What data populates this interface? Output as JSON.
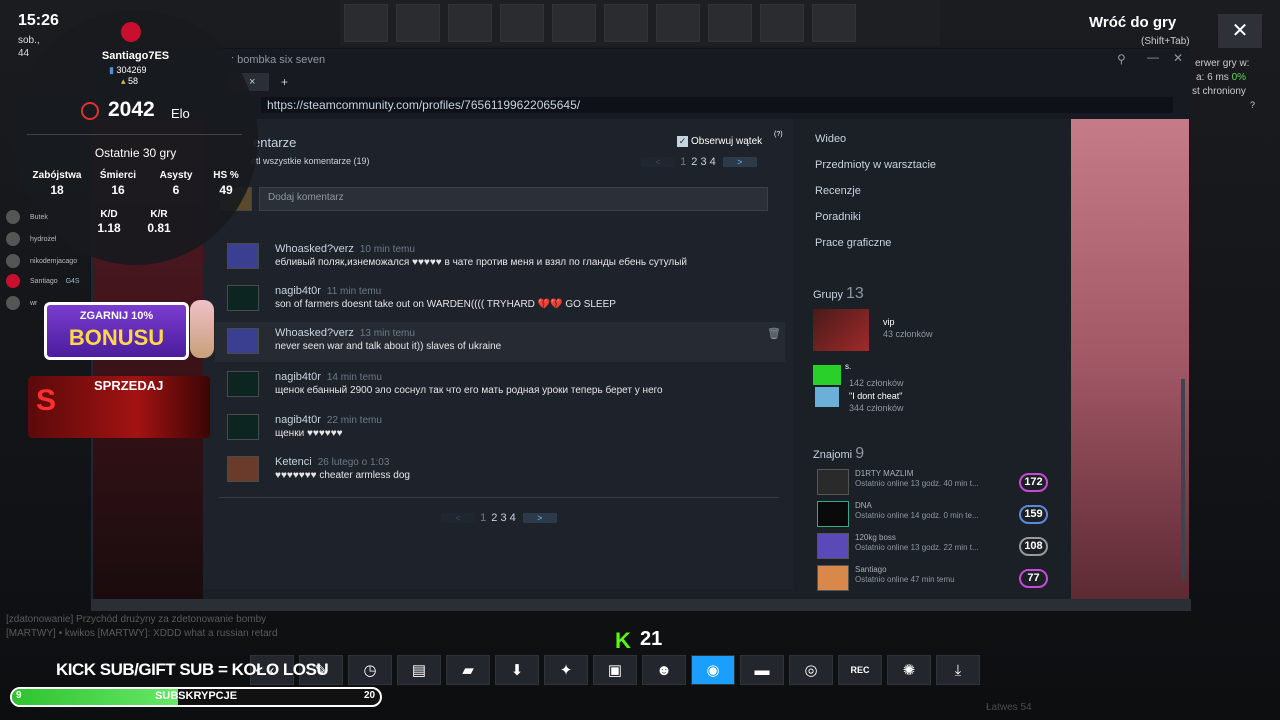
{
  "hud": {
    "clock": "15:26",
    "date_partial": "sob.,",
    "other_partial": "44",
    "profile_name": "Santiago7ES",
    "likes": "304269",
    "rank_count": "58",
    "elo_value": "2042",
    "elo_label": "Elo",
    "period_label": "Ostatnie 30 gry",
    "stats": [
      {
        "label": "Zabójstwa",
        "value": "18"
      },
      {
        "label": "Śmierci",
        "value": "16"
      },
      {
        "label": "Asysty",
        "value": "6"
      },
      {
        "label": "HS %",
        "value": "49"
      }
    ],
    "kd_label": "K/D",
    "kd_value": "1.18",
    "kr_label": "K/R",
    "kr_value": "0.81",
    "players": [
      "Butek",
      "hydrożel",
      "nikodemjacago",
      "Santiago",
      "wr"
    ],
    "santiago_tag": "G4S",
    "bonus_top": "ZGARNIJ 10%",
    "bonus_main": "BONUSU",
    "sell_label": "SPRZEDAJ",
    "return_label": "Wróć do gry",
    "return_shortcut": "(Shift+Tab)",
    "close_icon": "✕",
    "server_line1": "erwer gry w:",
    "server_ping": "6 ms",
    "server_loss": "0%",
    "server_ping_label": "a:",
    "server_line3": "st chroniony",
    "k_logo": "K",
    "viewer_count": "21",
    "kick_banner": "KICK SUB/GIFT SUB = KOŁO LOSU",
    "sub_current": "9",
    "sub_label": "SUBSKRYPCJE",
    "sub_goal": "20",
    "sub_progress": 0.45,
    "chat_line1": "[zdatonowanie] Przychód drużyny za zdetonowanie bomby",
    "chat_line2": "[MARTWY] • kwikos [MARTWY]: XDDD what a russian retard",
    "bottom_right_text": "Łatwes 54"
  },
  "taskbar": [
    {
      "name": "back-icon",
      "glyph": "‹"
    },
    {
      "name": "pencil-icon",
      "glyph": "✎"
    },
    {
      "name": "clock-icon",
      "glyph": "◷"
    },
    {
      "name": "notes-icon",
      "glyph": "▤"
    },
    {
      "name": "chat-icon",
      "glyph": "▰"
    },
    {
      "name": "download-icon",
      "glyph": "⬇"
    },
    {
      "name": "wrench-icon",
      "glyph": "✦"
    },
    {
      "name": "gallery-icon",
      "glyph": "▣"
    },
    {
      "name": "friends-icon",
      "glyph": "☻"
    },
    {
      "name": "browser-icon",
      "glyph": "◉",
      "active": true
    },
    {
      "name": "controller-icon",
      "glyph": "▬"
    },
    {
      "name": "globe-icon",
      "glyph": "◎"
    },
    {
      "name": "record-icon",
      "glyph": "REC"
    },
    {
      "name": "settings-icon",
      "glyph": "✺"
    },
    {
      "name": "minimize-icon",
      "glyph": "⤓"
    }
  ],
  "browser": {
    "title": ": bombka six seven",
    "url": "https://steamcommunity.com/profiles/76561199622065645/",
    "new_tab": "+",
    "tab_close": "×"
  },
  "comments": {
    "header": "entarze",
    "follow_label": "Obserwuj wątek",
    "follow_help": "(?)",
    "show_all": "etl wszystkie komentarze (19)",
    "pages": [
      "1",
      "2",
      "3",
      "4"
    ],
    "next": ">",
    "prev": "<",
    "add_placeholder": "Dodaj komentarz",
    "items": [
      {
        "author": "Whoasked?verz",
        "time": "10 min temu",
        "text": "ебливый поляк,изнеможался ♥♥♥♥♥ в чате против меня и взял по гланды ебень сутулый"
      },
      {
        "author": "nagib4t0r",
        "time": "11 min temu",
        "text": "son of farmers doesnt take out on WARDEN(((( TRYHARD 💔💔 GO SLEEP"
      },
      {
        "author": "Whoasked?verz",
        "time": "13 min temu",
        "text": "never seen war and talk about it)) slaves of ukraine"
      },
      {
        "author": "nagib4t0r",
        "time": "14 min temu",
        "text": "щенок ебанный 2900 эло соснул так что его мать родная уроки теперь берет у него"
      },
      {
        "author": "nagib4t0r",
        "time": "22 min temu",
        "text": "щенки ♥♥♥♥♥♥"
      },
      {
        "author": "Ketenci",
        "time": "26 lutego o 1:03",
        "text": "♥♥♥♥♥♥♥ cheater armless dog"
      }
    ]
  },
  "sidebar": {
    "links": [
      "Wideo",
      "Przedmioty w warsztacie",
      "Recenzje",
      "Poradniki",
      "Prace graficzne"
    ],
    "groups_label": "Grupy",
    "groups_count": "13",
    "groups": [
      {
        "name": "vip",
        "members": "43 członków"
      },
      {
        "name": "s.",
        "members": "142 członków"
      },
      {
        "name": "\"I dont cheat\"",
        "members": "344 członków"
      }
    ],
    "friends_label": "Znajomi",
    "friends_count": "9",
    "friends": [
      {
        "name": "D1RTY MAZLIM",
        "status": "Ostatnio online 13 godz. 40 min t...",
        "level": "172"
      },
      {
        "name": "DNA",
        "status": "Ostatnio online 14 godz. 0 min te...",
        "level": "159"
      },
      {
        "name": "120kg boss",
        "status": "Ostatnio online 13 godz. 22 min t...",
        "level": "108"
      },
      {
        "name": "Santiago",
        "status": "Ostatnio online 47 min temu",
        "level": "77"
      }
    ]
  },
  "colors": {
    "steam_bg": "#1b2838",
    "accent": "#1a9fff",
    "level_ring": "#c64bd4",
    "kick_green": "#53fc18"
  }
}
